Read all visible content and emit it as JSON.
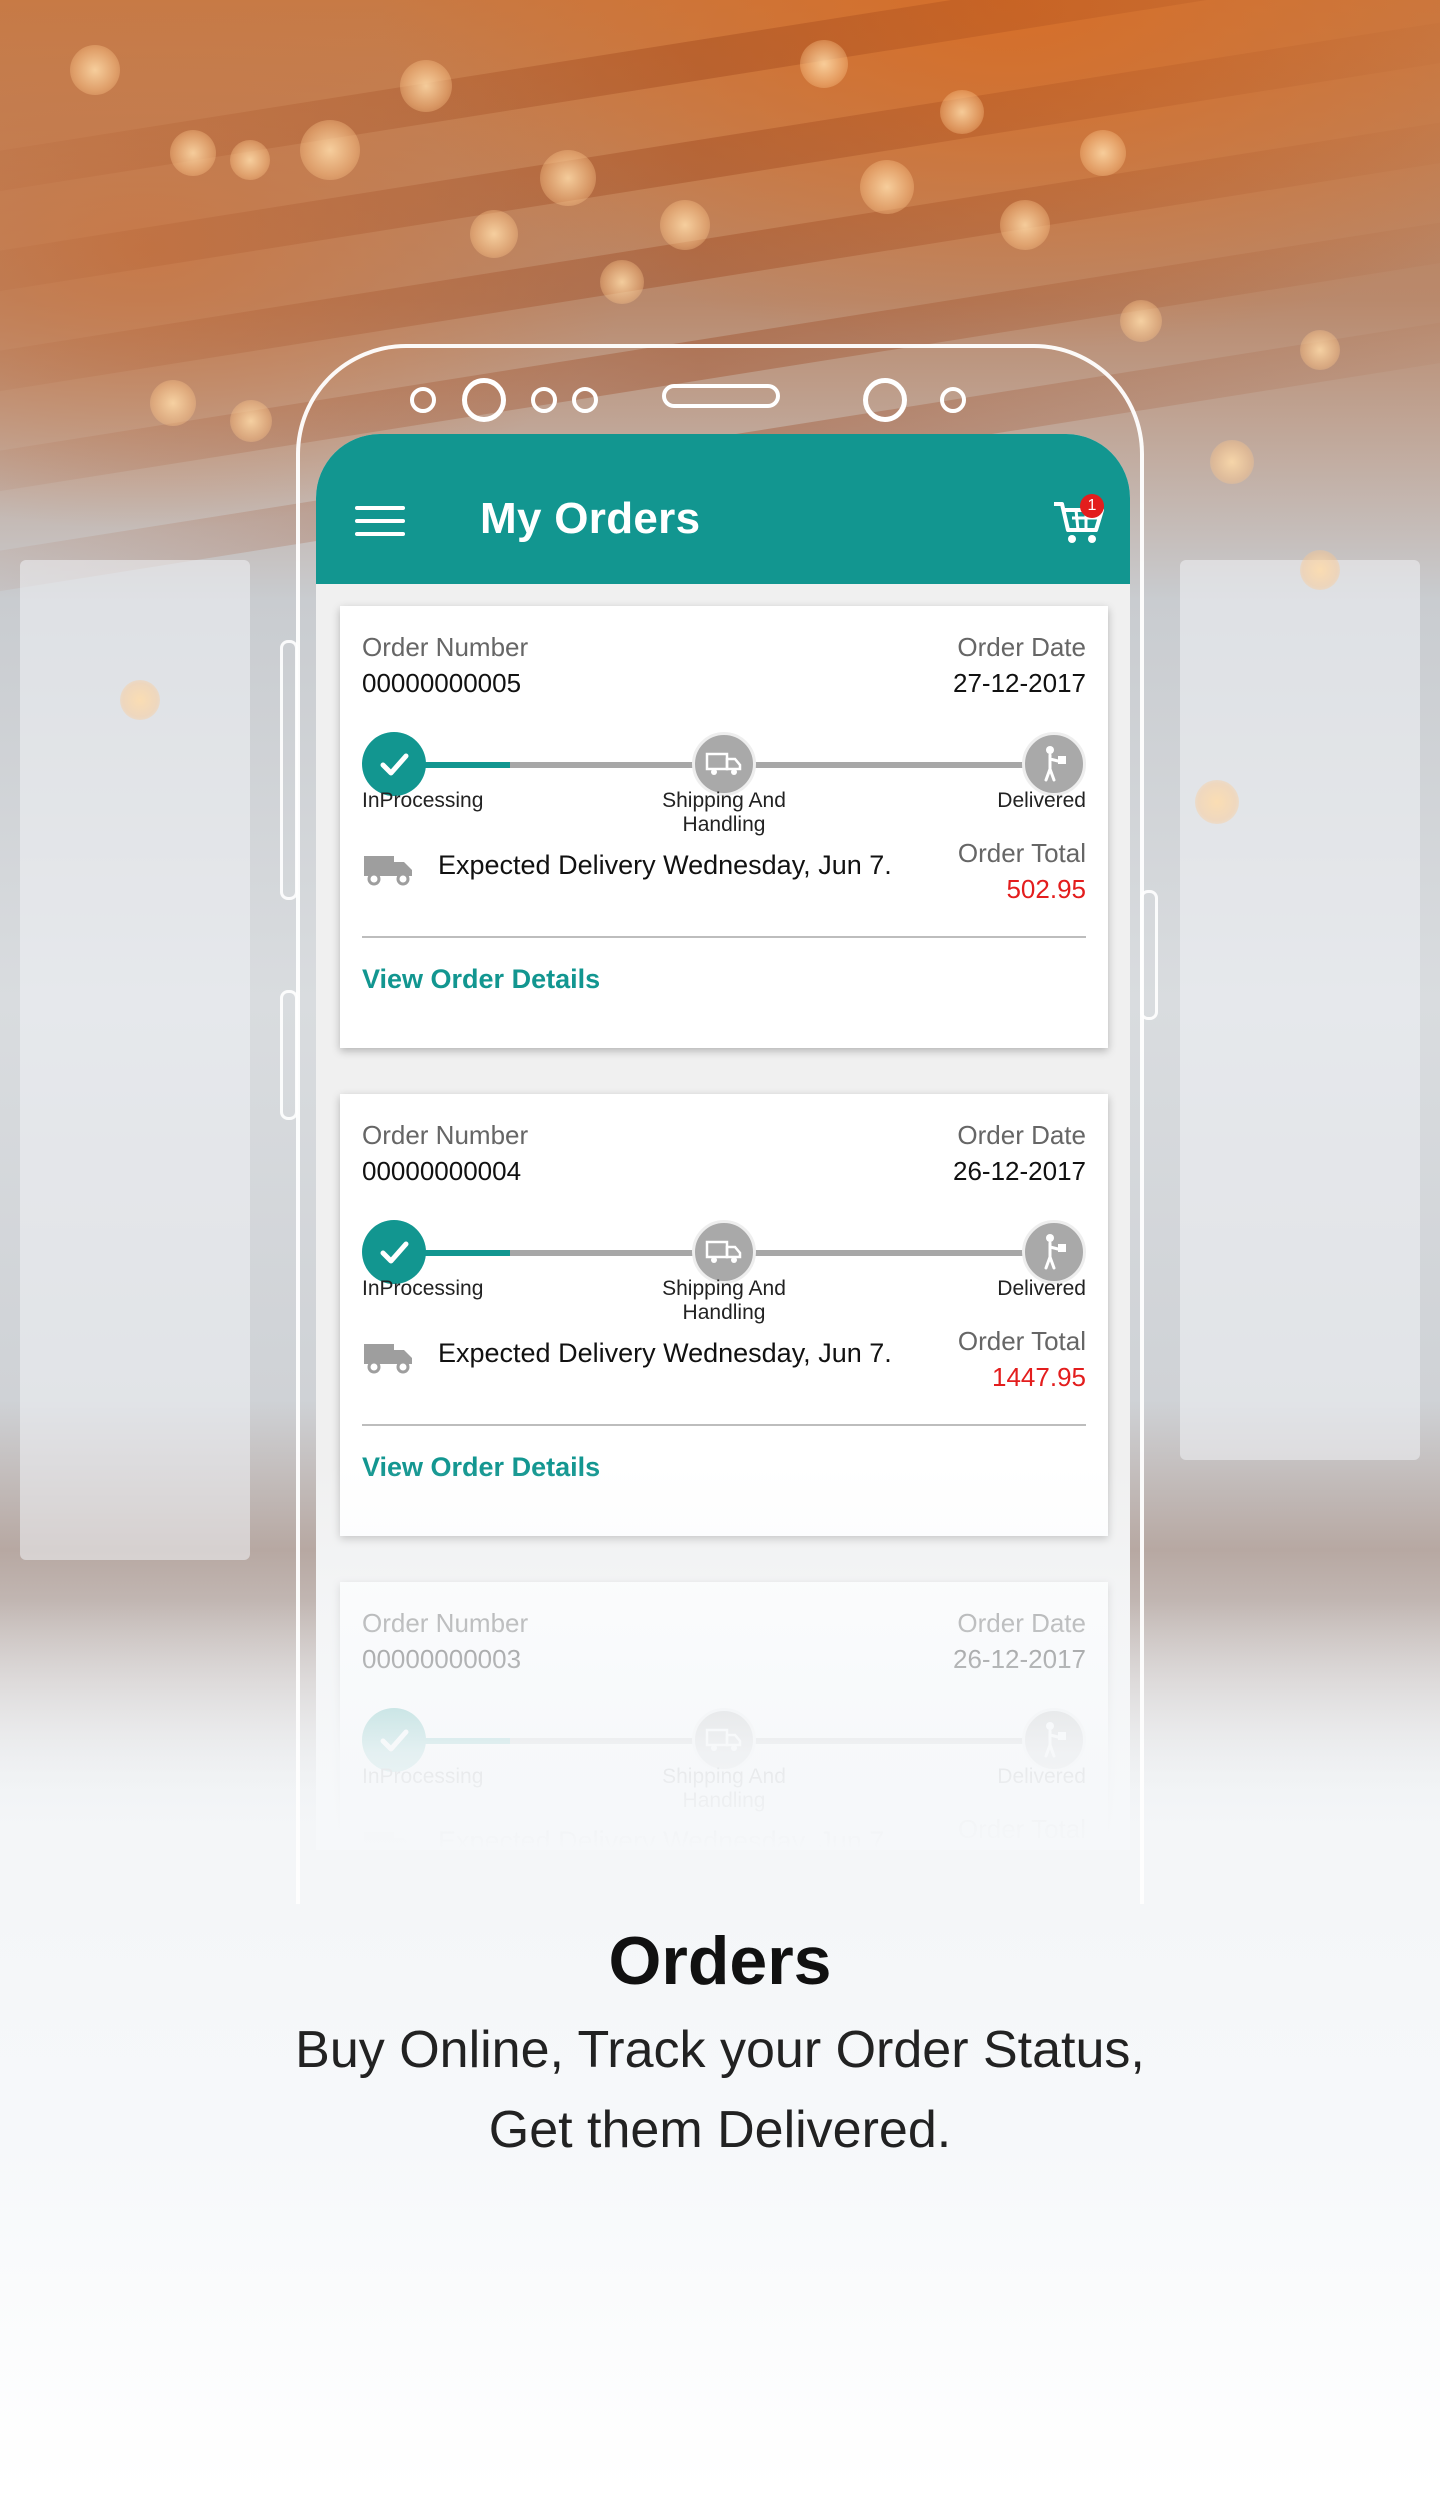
{
  "app": {
    "title": "My Orders",
    "cart_badge": "1",
    "accent_color": "#129690",
    "total_color": "#e31d1d"
  },
  "labels": {
    "order_number": "Order Number",
    "order_date": "Order Date",
    "order_total": "Order Total",
    "view_details": "View Order Details",
    "steps": [
      "InProcessing",
      "Shipping And Handling",
      "Delivered"
    ]
  },
  "orders": [
    {
      "number": "00000000005",
      "date": "27-12-2017",
      "delivery": "Expected Delivery Wednesday, Jun 7.",
      "total": "502.95",
      "progress": 0.18
    },
    {
      "number": "00000000004",
      "date": "26-12-2017",
      "delivery": "Expected Delivery Wednesday, Jun 7.",
      "total": "1447.95",
      "progress": 0.18
    },
    {
      "number": "00000000003",
      "date": "26-12-2017",
      "delivery": "Expected Delivery Wednesday, Jun 7.",
      "total": "",
      "progress": 0.18
    }
  ],
  "promo": {
    "headline": "Orders",
    "line1": "Buy Online, Track your Order Status,",
    "line2": "Get them Delivered."
  },
  "icons": [
    "menu-icon",
    "cart-icon",
    "check-icon",
    "truck-icon",
    "delivery-person-icon"
  ]
}
